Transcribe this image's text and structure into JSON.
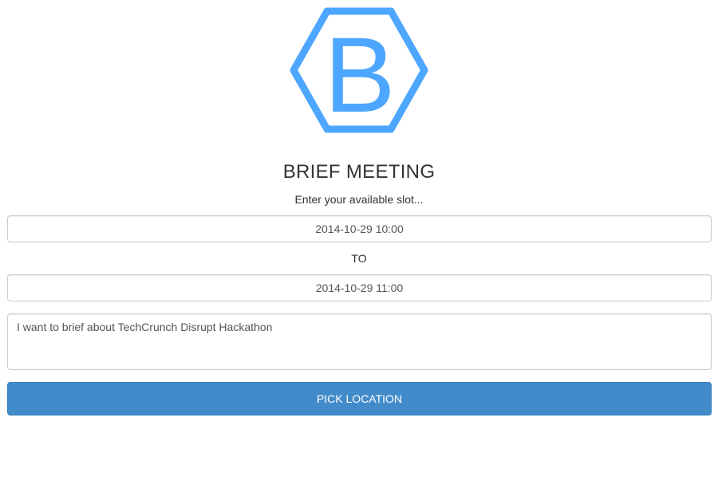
{
  "brand": {
    "logo_icon": "hexagon-b-logo",
    "logo_letter": "B",
    "accent_color": "#4da6ff"
  },
  "header": {
    "title": "BRIEF MEETING",
    "subtitle": "Enter your available slot..."
  },
  "form": {
    "from_value": "2014-10-29 10:00",
    "to_label": "TO",
    "to_value": "2014-10-29 11:00",
    "message_value": "I want to brief about TechCrunch Disrupt Hackathon",
    "submit_label": "PICK LOCATION",
    "submit_color": "#428bca"
  }
}
